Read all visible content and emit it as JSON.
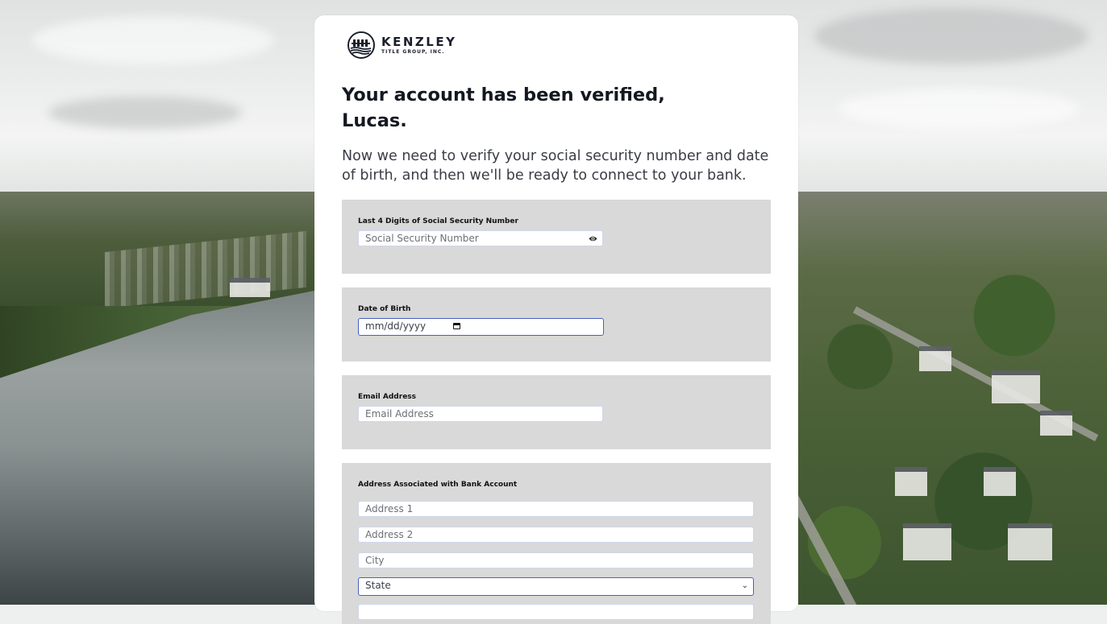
{
  "brand": {
    "name": "KENZLEY",
    "subtitle": "TITLE GROUP, INC."
  },
  "heading": {
    "line1": "Your account has been verified,",
    "line2": "Lucas."
  },
  "intro": "Now we need to verify your social security number and date of birth, and then we'll be ready to connect to your bank.",
  "ssn": {
    "label": "Last 4 Digits of Social Security Number",
    "placeholder": "Social Security Number"
  },
  "dob": {
    "label": "Date of Birth",
    "placeholder": "mm/dd/yyyy"
  },
  "email": {
    "label": "Email Address",
    "placeholder": "Email Address"
  },
  "address": {
    "label": "Address Associated with Bank Account",
    "address1_placeholder": "Address 1",
    "address2_placeholder": "Address 2",
    "city_placeholder": "City",
    "state_selected": "State"
  },
  "colors": {
    "section_bg": "#d9d9d9",
    "focus_border": "#4a5fc4",
    "heading": "#141821"
  }
}
